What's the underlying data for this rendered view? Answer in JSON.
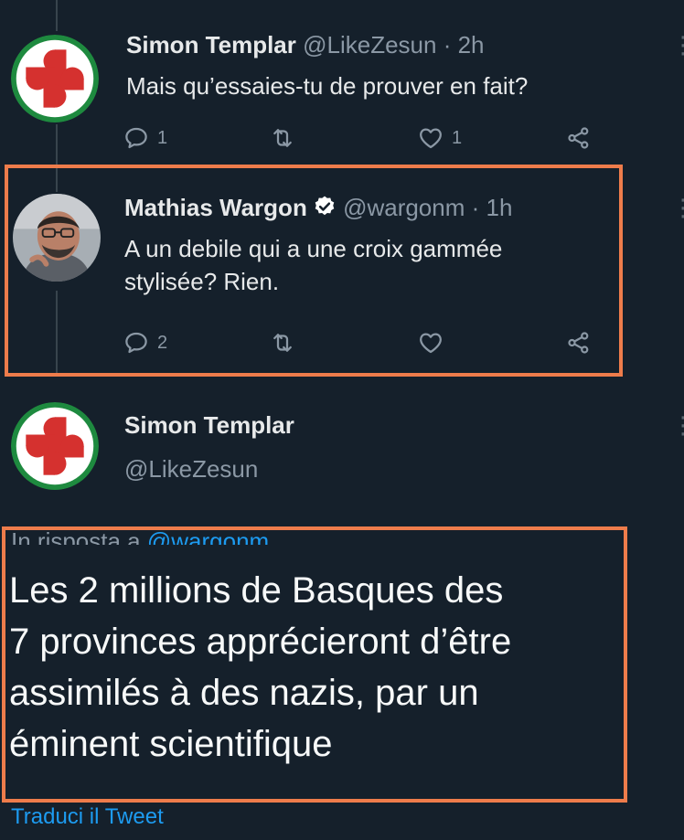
{
  "tweets": [
    {
      "name": "Simon Templar",
      "handle": "@LikeZesun",
      "time": "· 2h",
      "text": "Mais qu’essaies-tu de prouver en fait?",
      "reply_count": "1",
      "like_count": "1"
    },
    {
      "name": "Mathias Wargon",
      "handle": "@wargonm",
      "time": "· 1h",
      "verified": true,
      "text_line1": "A un debile qui a une croix gammée",
      "text_line2": "stylisée? Rien.",
      "reply_count": "2"
    }
  ],
  "focused": {
    "name": "Simon Templar",
    "handle": "@LikeZesun",
    "reply_label": "In risposta a",
    "reply_mention": "@wargonm",
    "lines": [
      "Les 2 millions de Basques des",
      "7 provinces apprécieront d’être",
      "assimilés à des nazis, par un",
      "éminent scientifique"
    ],
    "translate": "Traduci il Tweet"
  },
  "colors": {
    "background": "#15202b",
    "highlight_frame": "#ee7c4b",
    "link": "#1d9bf0",
    "lauburu_red": "#d5312f",
    "lauburu_green": "#1e8a3f"
  },
  "icons": [
    "lauburu-logo",
    "reply-icon",
    "retweet-icon",
    "like-icon",
    "share-icon",
    "verified-icon",
    "more-icon"
  ]
}
